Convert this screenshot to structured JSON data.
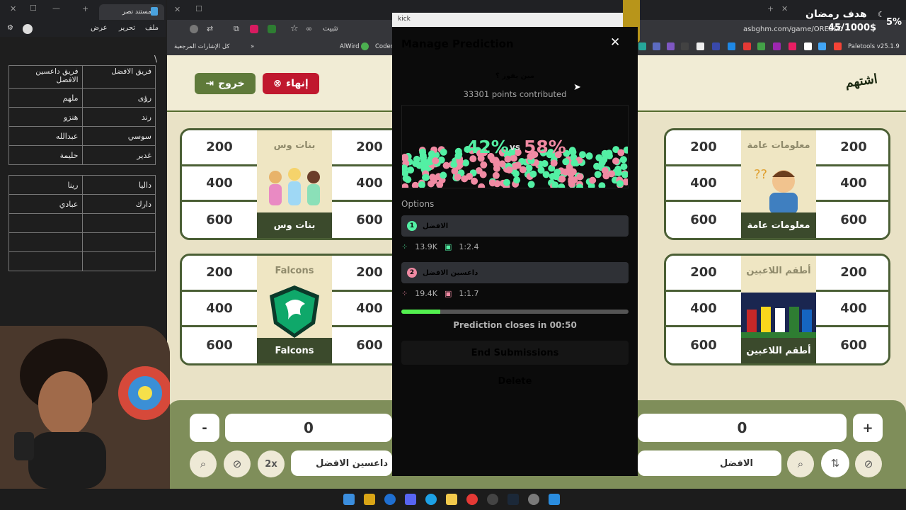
{
  "doc": {
    "tab_title": "مستند نصر",
    "menu": [
      "ملف",
      "تحرير",
      "عرض"
    ],
    "marker": "\\",
    "table1": [
      [
        "فريق داعسين الافضل",
        "فريق الافضل"
      ],
      [
        "ملهم",
        "رؤى"
      ],
      [
        "هنزو",
        "رند"
      ],
      [
        "عبدالله",
        "سوسي"
      ],
      [
        "حليمة",
        "غدير"
      ]
    ],
    "table2": [
      [
        "رينا",
        "داليا"
      ],
      [
        "عبادي",
        "دارك"
      ],
      [
        "",
        ""
      ],
      [
        "",
        ""
      ],
      [
        "",
        ""
      ]
    ]
  },
  "browser": {
    "install_label": "تثبيت",
    "url": "asbghm.com/game/ORE8LO",
    "bookmarks_folder": "كل الإشارات المرجعية",
    "bookmarks": [
      "AlWird",
      "Coden"
    ],
    "ext_label": "Paletools v25.1.9"
  },
  "game": {
    "exit_label": "خروج",
    "end_label": "إنهاء",
    "logo_text": "اشتهم",
    "cards": [
      {
        "title": "بنات وس",
        "caption": "بنات وس",
        "left": [
          "200",
          "400",
          "600"
        ],
        "right": [
          "200",
          "400",
          "600"
        ]
      },
      {
        "title": "معلومات عامة",
        "caption": "معلومات عامة",
        "left": [
          "200",
          "400",
          "600"
        ],
        "right": [
          "200",
          "400",
          "600"
        ]
      },
      {
        "title": "Falcons",
        "caption": "Falcons",
        "left": [
          "200",
          "400",
          "600"
        ],
        "right": [
          "200",
          "400",
          "600"
        ]
      },
      {
        "title": "أطقم اللاعبين",
        "caption": "أطقم اللاعبين",
        "left": [
          "200",
          "400",
          "600"
        ],
        "right": [
          "200",
          "400",
          "600"
        ]
      }
    ],
    "team_left": {
      "score": "0",
      "name": "داعسين الافضل",
      "minus": "-",
      "double": "2x"
    },
    "team_right": {
      "score": "0",
      "name": "الافضل",
      "plus": "+"
    }
  },
  "modal": {
    "window_label": "kick",
    "title": "Manage Prediction",
    "question": "مين يفوز ؟",
    "points": "33301 points contributed",
    "pct_a": "42%",
    "pct_vs": "vs",
    "pct_b": "58%",
    "options_label": "Options",
    "options": [
      {
        "num": "1",
        "label": "الافضل",
        "points": "13.9K",
        "ratio": "1:2.4",
        "color": "#53f0a4"
      },
      {
        "num": "2",
        "label": "داعسين الافضل",
        "points": "19.4K",
        "ratio": "1:1.7",
        "color": "#f08aa3"
      }
    ],
    "progress_fraction": 0.17,
    "closes_text": "Prediction closes in 00:50",
    "end_label": "End Submissions",
    "delete_label": "Delete"
  },
  "overlay": {
    "goal_title": "هدف رمضان",
    "goal_value": "45/1000$",
    "goal_pct": "5%"
  }
}
